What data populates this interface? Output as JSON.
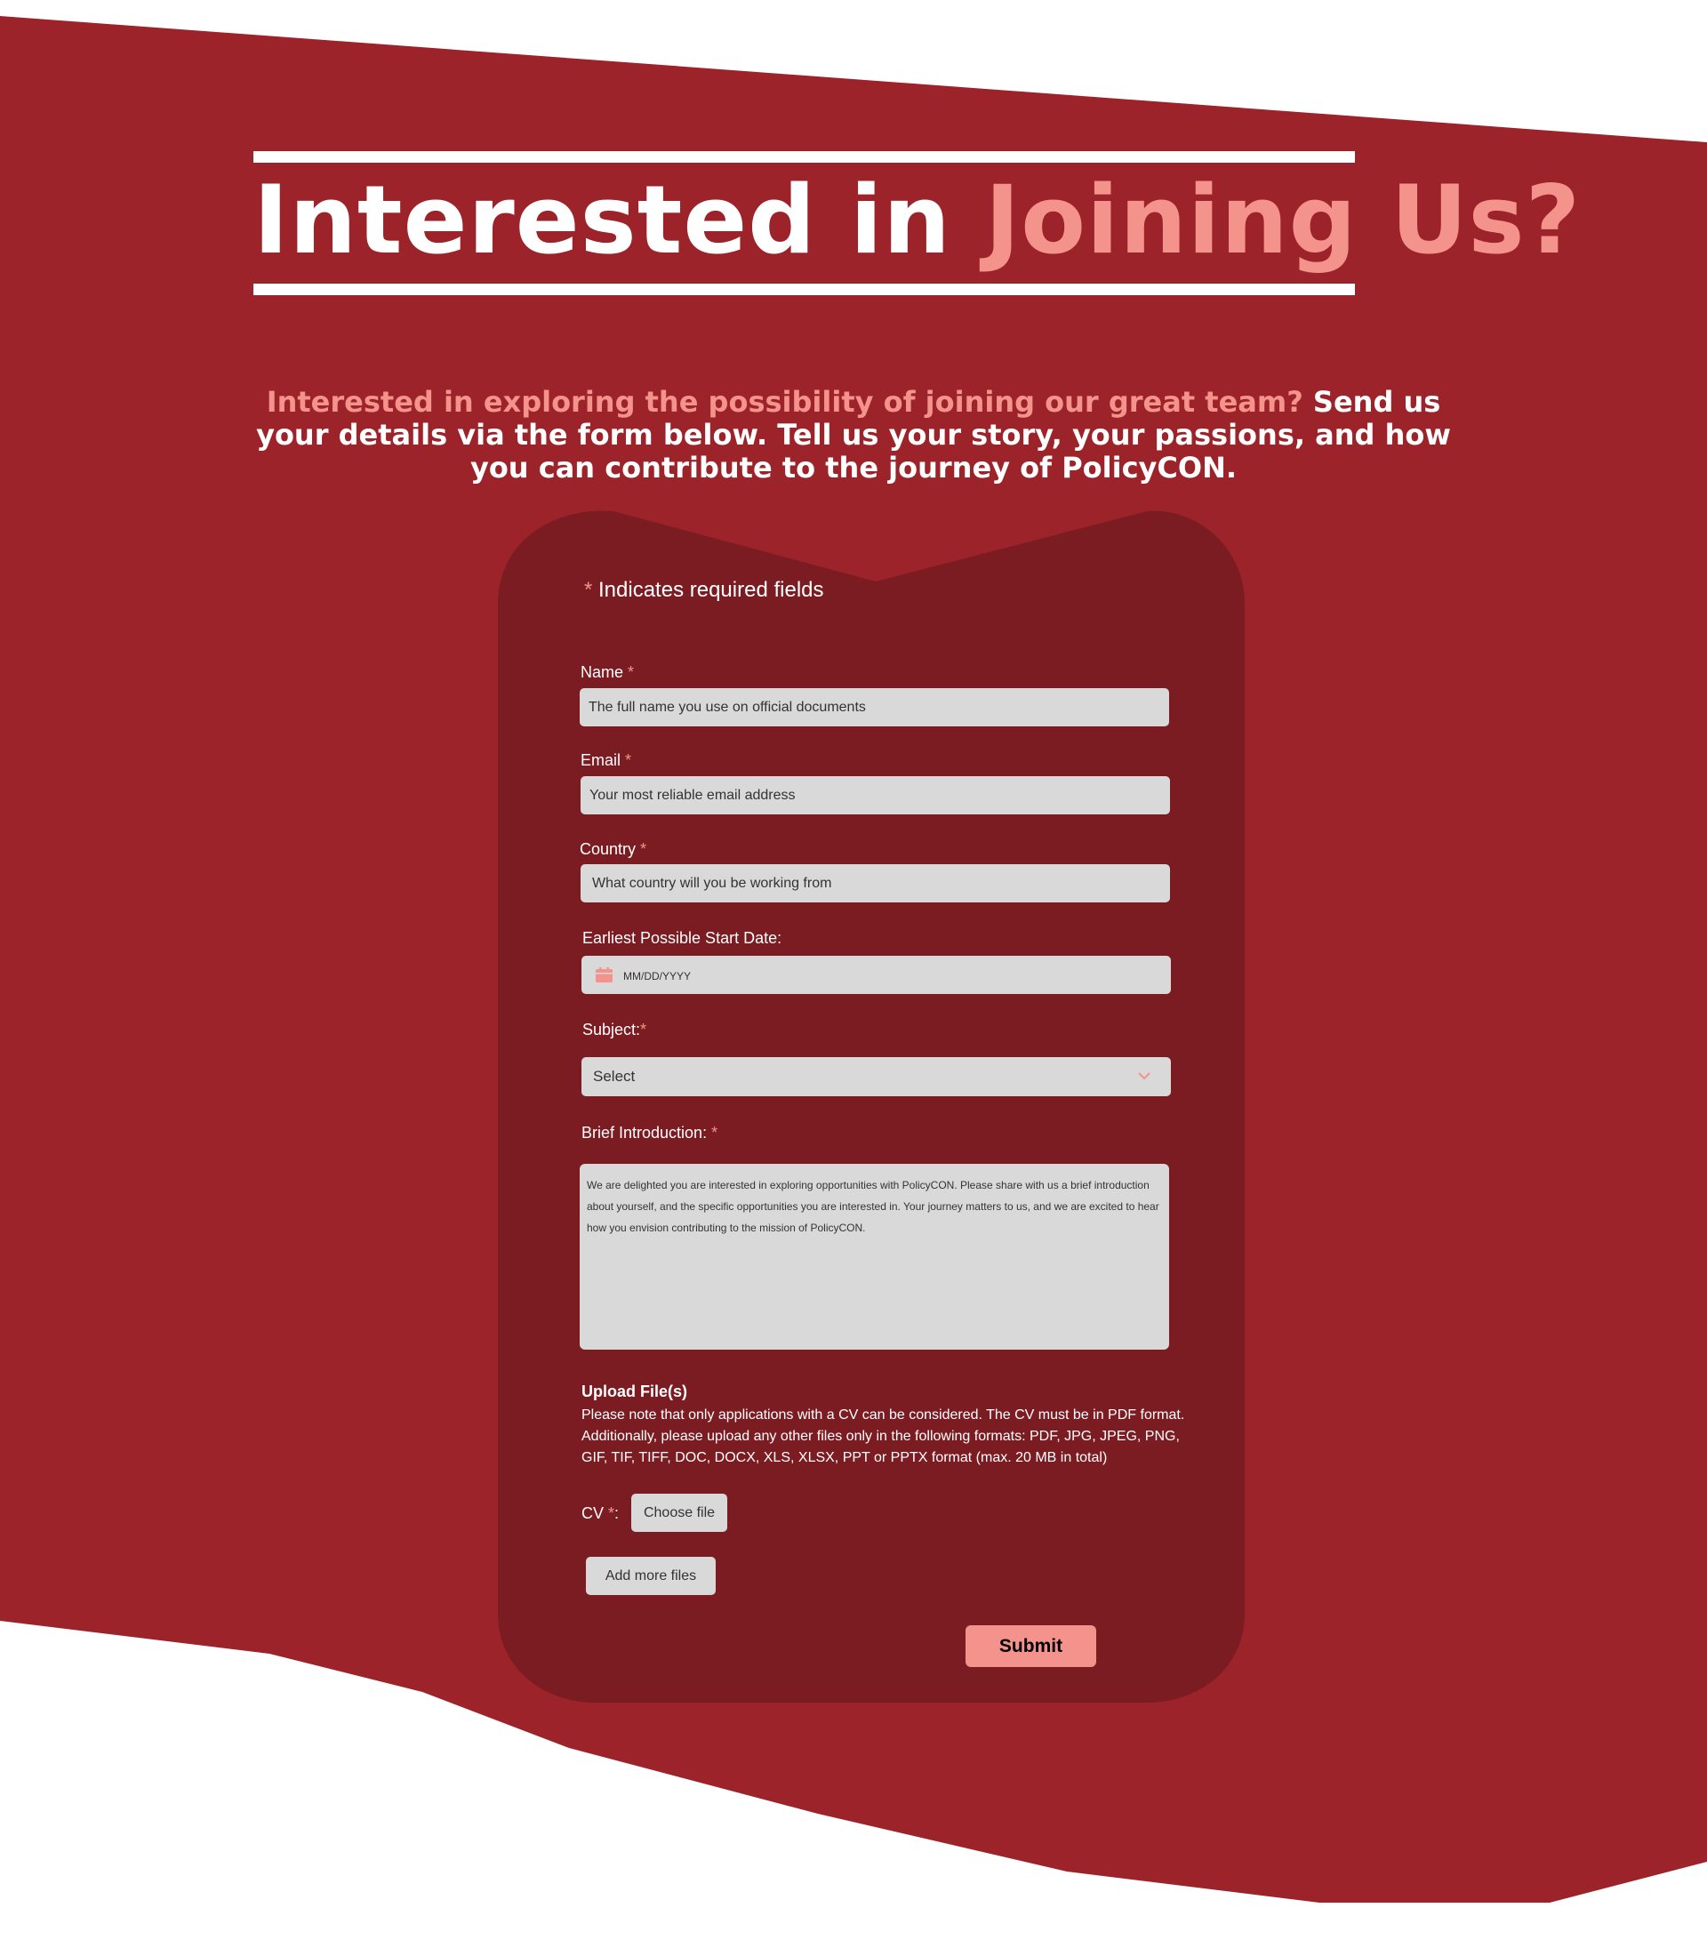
{
  "colors": {
    "background_red": "#9b2329",
    "card_red": "#7b1c22",
    "accent_pink": "#f4928c",
    "field_gray": "#d9d9d9"
  },
  "heading": {
    "title_main": "Interested in ",
    "title_accent": "Joining Us?"
  },
  "intro": {
    "accent": "Interested in exploring the possibility of joining our great team?",
    "text": " Send us your details via the form below. Tell us your story, your passions, and how you can contribute to the journey of PolicyCON."
  },
  "form": {
    "required_star": "*",
    "required_note": "Indicates required fields",
    "name": {
      "label": "Name",
      "placeholder": "The full name you use on official documents"
    },
    "email": {
      "label": "Email",
      "placeholder": "Your most reliable email address"
    },
    "country": {
      "label": "Country",
      "placeholder": "What country will you be working from"
    },
    "start_date": {
      "label": "Earliest Possible Start Date:",
      "placeholder": "MM/DD/YYYY",
      "icon": "calendar-icon"
    },
    "subject": {
      "label": "Subject:",
      "value": "Select",
      "icon": "chevron-down-icon"
    },
    "introduction": {
      "label": "Brief Introduction:",
      "text": "We are delighted you are interested  in exploring opportunities with PolicyCON. Please share with us a brief introduction about yourself, and the specific opportunities you are interested in. Your journey matters to us, and we are excited to hear how you envision contributing to the mission of PolicyCON."
    },
    "upload": {
      "title": "Upload File(s)",
      "note": "Please note that only applications with a CV can be considered. The CV must be in PDF format. Additionally, please upload any other files only in the following formats: PDF, JPG, JPEG, PNG, GIF, TIF, TIFF, DOC, DOCX, XLS, XLSX, PPT or PPTX format (max. 20 MB in total)",
      "cv_label": "CV",
      "cv_colon": ":",
      "choose_file": "Choose file",
      "add_more": "Add more files"
    },
    "submit": "Submit"
  }
}
